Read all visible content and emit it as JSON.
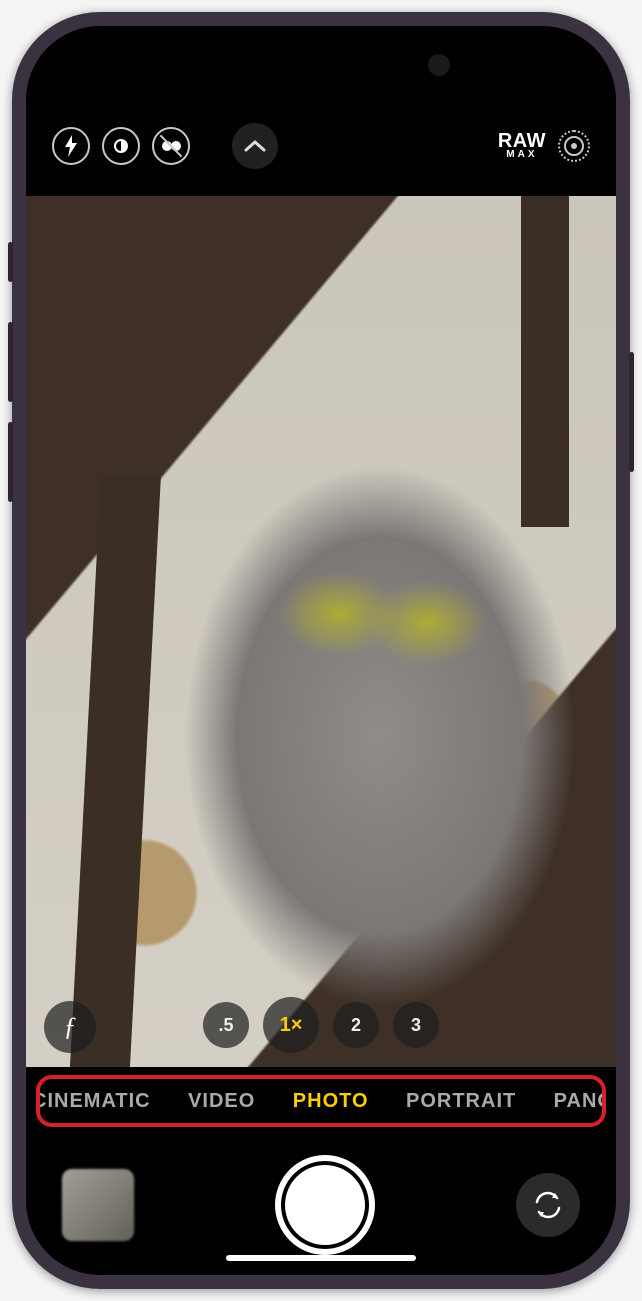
{
  "top_controls": {
    "raw_label_top": "RAW",
    "raw_label_bottom": "MAX"
  },
  "zoom": {
    "levels": [
      ".5",
      "1×",
      "2",
      "3"
    ],
    "active_index": 1
  },
  "modes": {
    "items": [
      "CINEMATIC",
      "VIDEO",
      "PHOTO",
      "PORTRAIT",
      "PANO"
    ],
    "active_index": 2
  },
  "icons": {
    "flash": "flash-icon",
    "night": "night-mode-icon",
    "live_off": "live-photo-off-icon",
    "chevron_up": "chevron-up-icon",
    "raw": "raw-toggle",
    "live": "live-photo-icon",
    "f_button": "photographic-styles-icon",
    "thumbnail": "last-photo-thumbnail",
    "shutter": "shutter-button",
    "flip": "flip-camera-icon"
  },
  "annotation": {
    "highlight": "mode-selector-highlight"
  }
}
